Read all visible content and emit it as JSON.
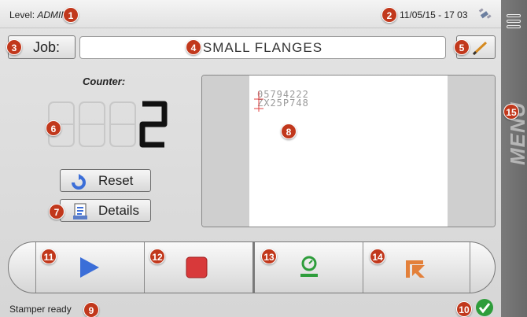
{
  "header": {
    "level_label": "Level:",
    "level_value": "ADMIN",
    "datetime": "11/05/15 - 17 03"
  },
  "job": {
    "label": "Job:",
    "value": "SMALL FLANGES"
  },
  "counter": {
    "label": "Counter:",
    "value": "2"
  },
  "buttons": {
    "reset": "Reset",
    "details": "Details"
  },
  "preview": {
    "line1": "05794222",
    "line2": "ZX25P748"
  },
  "status": {
    "text": "Stamper ready"
  },
  "menu": {
    "label": "MENU"
  },
  "callouts": [
    "1",
    "2",
    "3",
    "4",
    "5",
    "6",
    "7",
    "8",
    "9",
    "10",
    "11",
    "12",
    "13",
    "14",
    "15"
  ],
  "icons": {
    "wifi": "satellite-icon",
    "edit": "pencil-icon",
    "reset": "refresh-icon",
    "details": "document-icon",
    "play": "play-icon",
    "stop": "stop-icon",
    "stamp": "stamp-icon",
    "home": "home-arrow-icon",
    "ok": "check-icon",
    "menu": "hamburger-icon"
  },
  "colors": {
    "badge": "#c1381c",
    "play": "#3b6ed8",
    "stop": "#d8393a",
    "ok": "#2e9d3b",
    "menu": "#6e6e6e"
  }
}
